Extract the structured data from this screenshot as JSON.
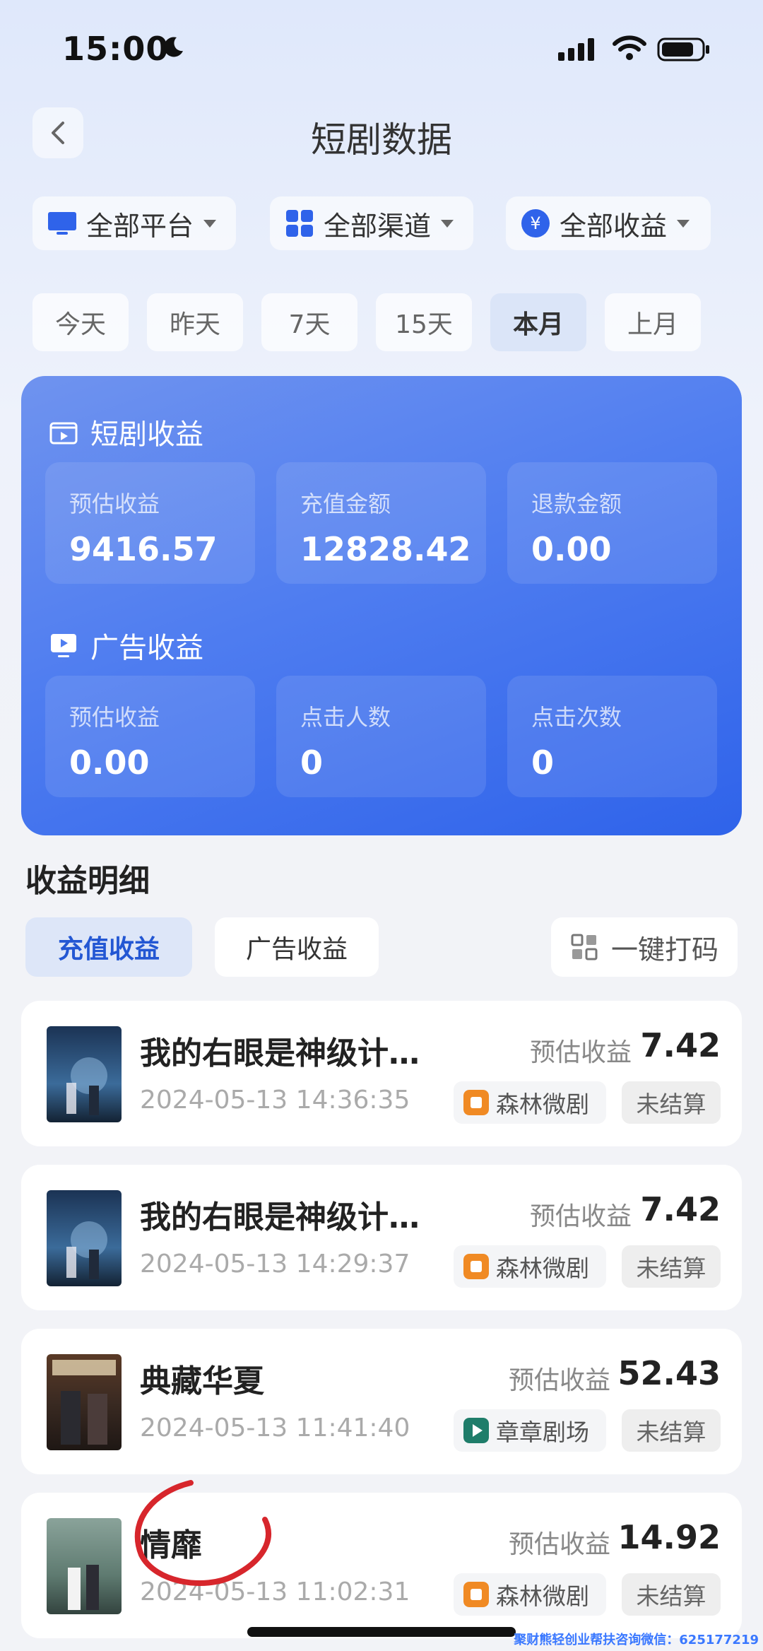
{
  "status_bar": {
    "time": "15:00"
  },
  "header": {
    "title": "短剧数据"
  },
  "filters": [
    {
      "label": "全部平台",
      "icon": "monitor-icon"
    },
    {
      "label": "全部渠道",
      "icon": "grid-icon"
    },
    {
      "label": "全部收益",
      "icon": "yuan-icon"
    }
  ],
  "date_tabs": [
    "今天",
    "昨天",
    "7天",
    "15天",
    "本月",
    "上月"
  ],
  "active_date_tab": "本月",
  "drama_income": {
    "title": "短剧收益",
    "stats": [
      {
        "label": "预估收益",
        "value": "9416.57"
      },
      {
        "label": "充值金额",
        "value": "12828.42"
      },
      {
        "label": "退款金额",
        "value": "0.00"
      }
    ]
  },
  "ad_income": {
    "title": "广告收益",
    "stats": [
      {
        "label": "预估收益",
        "value": "0.00"
      },
      {
        "label": "点击人数",
        "value": "0"
      },
      {
        "label": "点击次数",
        "value": "0"
      }
    ]
  },
  "detail": {
    "title": "收益明细",
    "tabs": [
      "充值收益",
      "广告收益"
    ],
    "code_button": "一键打码"
  },
  "items": [
    {
      "name": "我的右眼是神级计…",
      "datetime": "2024-05-13 14:36:35",
      "earn_label": "预估收益",
      "amount": "7.42",
      "platform": "森林微剧",
      "status": "未结算"
    },
    {
      "name": "我的右眼是神级计…",
      "datetime": "2024-05-13 14:29:37",
      "earn_label": "预估收益",
      "amount": "7.42",
      "platform": "森林微剧",
      "status": "未结算"
    },
    {
      "name": "典藏华夏",
      "datetime": "2024-05-13 11:41:40",
      "earn_label": "预估收益",
      "amount": "52.43",
      "platform": "章章剧场",
      "status": "未结算"
    },
    {
      "name": "情靡",
      "datetime": "2024-05-13 11:02:31",
      "earn_label": "预估收益",
      "amount": "14.92",
      "platform": "森林微剧",
      "status": "未结算"
    }
  ],
  "watermark": "聚财熊轻创业帮扶咨询微信：625177219",
  "colors": {
    "accent": "#2f63ea",
    "card_start": "#6f93ef",
    "redmark": "#d7262c"
  }
}
